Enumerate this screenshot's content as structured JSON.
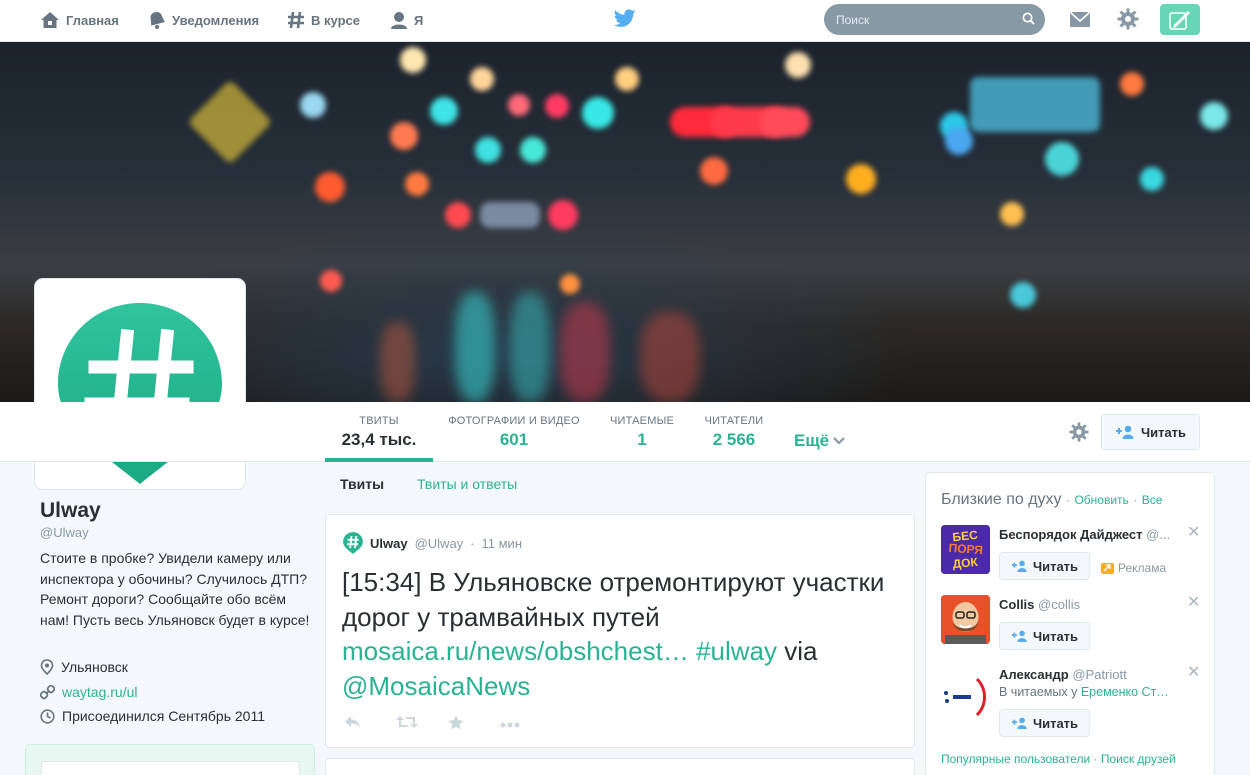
{
  "topnav": {
    "home_label": "Главная",
    "notifications_label": "Уведомления",
    "discover_label": "В курсе",
    "me_label": "Я",
    "search_placeholder": "Поиск"
  },
  "profile_nav": {
    "tweets": {
      "label": "ТВИТЫ",
      "value": "23,4 тыс."
    },
    "media": {
      "label": "ФОТОГРАФИИ И ВИДЕО",
      "value": "601"
    },
    "following": {
      "label": "ЧИТАЕМЫЕ",
      "value": "1"
    },
    "followers": {
      "label": "ЧИТАТЕЛИ",
      "value": "2 566"
    },
    "more_label": "Ещё",
    "follow_label": "Читать"
  },
  "profile": {
    "name": "Ulway",
    "handle": "@Ulway",
    "bio": "Стоите в пробке? Увидели камеру или инспектора у обочины? Случилось ДТП? Ремонт дороги? Сообщайте обо всём нам! Пусть весь Ульяновск будет в курсе!",
    "location": "Ульяновск",
    "website": "waytag.ru/ul",
    "joined": "Присоединился Сентябрь 2011"
  },
  "timeline": {
    "tab_tweets": "Твиты",
    "tab_replies": "Твиты и ответы",
    "tweet": {
      "name": "Ulway",
      "handle": "@Ulway",
      "sep": "·",
      "time": "11 мин",
      "text": "[15:34] В Ульяновске отремонтируют участки дорог у трамвайных путей ",
      "link": "mosaica.ru/news/obshchest…",
      "hashtag": "#ulway",
      "via": " via ",
      "mention": "@MosaicaNews"
    }
  },
  "who_to_follow": {
    "title": "Близкие по духу",
    "sep": "·",
    "refresh": "Обновить",
    "all": "Все",
    "follow_label": "Читать",
    "items": [
      {
        "name": "Беспорядок Дайджест",
        "handle": "@...",
        "ad": "Реклама",
        "avatar_text": "БЕС ПОРЯ ДОК"
      },
      {
        "name": "Collis",
        "handle": "@collis"
      },
      {
        "name": "Александр",
        "handle": "@Patriott",
        "context": "В читаемых у ",
        "context_name": "Еременко Ст…"
      }
    ],
    "footer_popular": "Популярные пользователи",
    "footer_dot": " · ",
    "footer_find": "Поиск друзей"
  },
  "colors": {
    "accent": "#29b393",
    "compose": "#66d6b4",
    "avatar_gradient_top": "#30c39e",
    "avatar_gradient_bottom": "#1aa982"
  }
}
